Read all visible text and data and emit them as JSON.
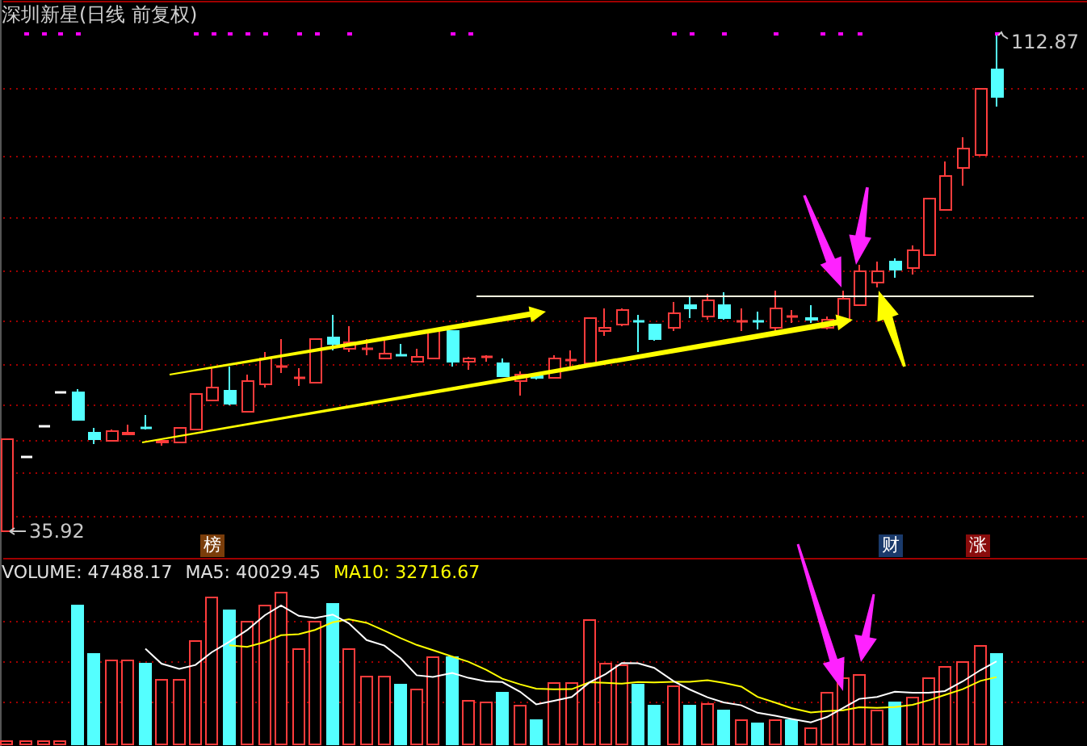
{
  "title": "深圳新星(日线 前复权)",
  "price_max": "112.87",
  "price_min": "35.92",
  "event_badges": [
    {
      "label": "榜",
      "color": "#7a3d0a"
    },
    {
      "label": "财",
      "color": "#1a3a6b"
    },
    {
      "label": "涨",
      "color": "#8a0c0c"
    }
  ],
  "volume_header": [
    {
      "label": "VOLUME: 47488.17",
      "kind": "volume"
    },
    {
      "label": "MA5: 40029.45",
      "kind": "ma5"
    },
    {
      "label": "MA10: 32716.67",
      "kind": "ma10"
    }
  ]
}
